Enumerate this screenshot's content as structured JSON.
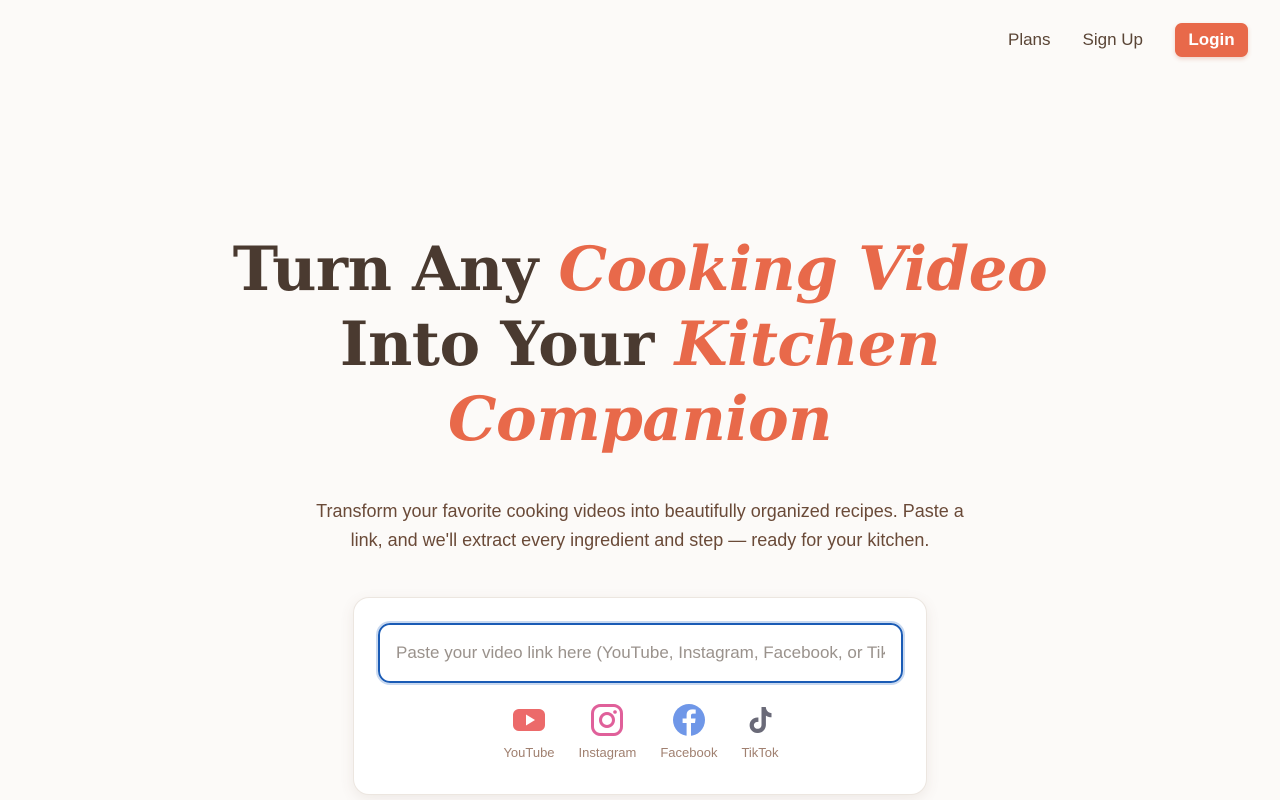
{
  "nav": {
    "plans": "Plans",
    "signup": "Sign Up",
    "login": "Login"
  },
  "hero": {
    "line1_plain": "Turn Any",
    "line1_accent": "Cooking Video",
    "line2_plain": "Into Your",
    "line2_accent": "Kitchen",
    "line3_accent": "Companion",
    "subtitle": "Transform your favorite cooking videos into beautifully organized recipes. Paste a link, and we'll extract every ingredient and step — ready for your kitchen."
  },
  "input": {
    "placeholder": "Paste your video link here (YouTube, Instagram, Facebook, or TikTok)",
    "value": ""
  },
  "platforms": [
    {
      "label": "YouTube",
      "icon": "youtube-icon",
      "color": "#ec6a6a"
    },
    {
      "label": "Instagram",
      "icon": "instagram-icon",
      "color": "#e0609a"
    },
    {
      "label": "Facebook",
      "icon": "facebook-icon",
      "color": "#6f97e8"
    },
    {
      "label": "TikTok",
      "icon": "tiktok-icon",
      "color": "#6a6a78"
    }
  ],
  "colors": {
    "accent": "#e8694a",
    "text": "#4a3a30",
    "background": "#fcfaf8"
  }
}
